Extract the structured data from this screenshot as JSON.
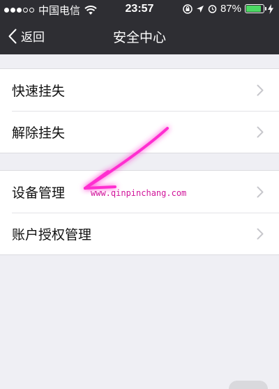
{
  "status_bar": {
    "carrier": "中国电信",
    "time": "23:57",
    "battery_percent": "87%",
    "battery_level": 0.87,
    "signal_full_dots": 3,
    "signal_total_dots": 5
  },
  "nav": {
    "back_label": "返回",
    "title": "安全中心"
  },
  "groups": [
    {
      "items": [
        {
          "label": "快速挂失"
        },
        {
          "label": "解除挂失"
        }
      ]
    },
    {
      "items": [
        {
          "label": "设备管理"
        },
        {
          "label": "账户授权管理"
        }
      ]
    }
  ],
  "watermark": "www.qinpinchang.com",
  "colors": {
    "bar_bg": "#2e2e33",
    "page_bg": "#efeff4",
    "arrow": "#ff2fd0",
    "battery_fill": "#4cd964"
  }
}
